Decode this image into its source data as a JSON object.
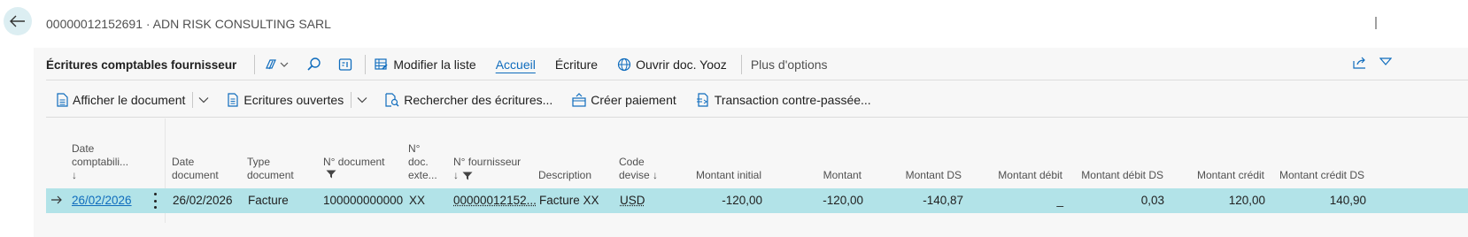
{
  "header": {
    "title": "00000012152691 · ADN RISK CONSULTING SARL"
  },
  "actionbar": {
    "title": "Écritures comptables fournisseur",
    "modify_list": "Modifier la liste",
    "tabs": [
      "Accueil",
      "Écriture",
      "Ouvrir doc. Yooz"
    ],
    "more": "Plus d'options"
  },
  "subbar": {
    "show_document": "Afficher le document",
    "open_entries": "Ecritures ouvertes",
    "find_entries": "Rechercher des écritures...",
    "create_payment": "Créer paiement",
    "reversed_transaction": "Transaction contre-passée..."
  },
  "table": {
    "headers": {
      "posting_date": [
        "Date",
        "comptabili...",
        "↓"
      ],
      "document_date": [
        "Date",
        "document"
      ],
      "document_type": [
        "Type",
        "document"
      ],
      "document_no": [
        "N° document"
      ],
      "external_doc": [
        "N°",
        "doc.",
        "exte..."
      ],
      "vendor_no": [
        "N° fournisseur",
        "↓"
      ],
      "description": [
        "Description"
      ],
      "currency": [
        "Code",
        "devise ↓"
      ],
      "original_amount": "Montant initial",
      "amount": "Montant",
      "amount_lcy": "Montant DS",
      "debit_amount": "Montant débit",
      "debit_amount_lcy": "Montant débit DS",
      "credit_amount": "Montant crédit",
      "credit_amount_lcy": "Montant crédit DS"
    },
    "rows": [
      {
        "posting_date": "26/02/2026",
        "document_date": "26/02/2026",
        "document_type": "Facture",
        "document_no": "100000000000",
        "external_doc": "XX",
        "vendor_no": "00000012152...",
        "description": "Facture XX",
        "currency": "USD",
        "original_amount": "-120,00",
        "amount": "-120,00",
        "amount_lcy": "-140,87",
        "debit_amount": "_",
        "debit_amount_lcy": "0,03",
        "credit_amount": "120,00",
        "credit_amount_lcy": "140,90"
      }
    ]
  },
  "colors": {
    "accent": "#0f6cbd",
    "selected_row": "#b2e3e8",
    "back_button_bg": "#dceef2"
  }
}
